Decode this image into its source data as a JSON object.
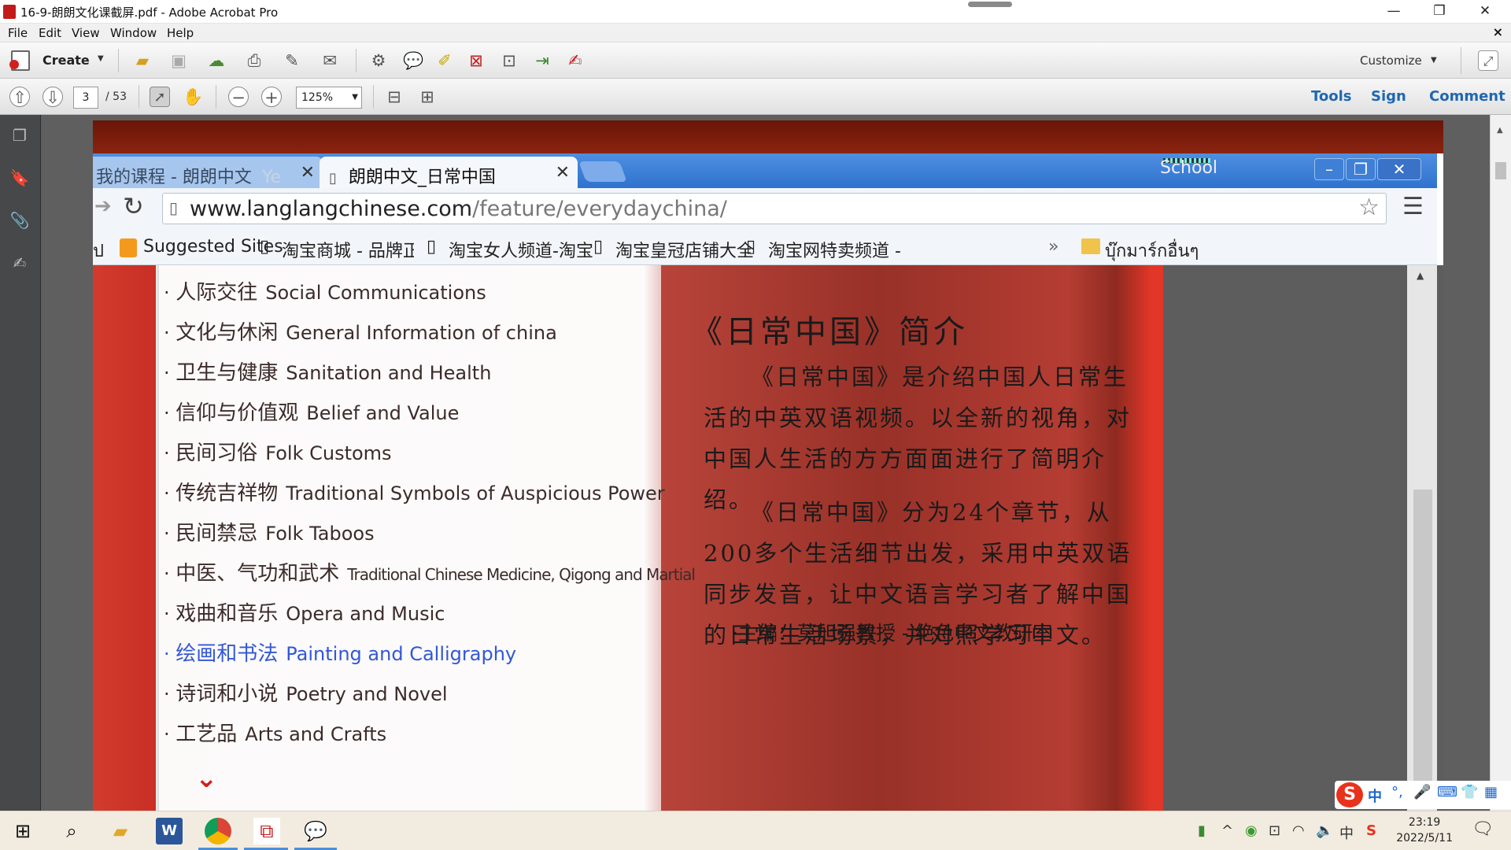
{
  "window": {
    "title": "16-9-朗朗文化课截屏.pdf - Adobe Acrobat Pro",
    "controls": {
      "minimize": "—",
      "maximize": "❐",
      "close": "✕"
    }
  },
  "menu": {
    "items": [
      "File",
      "Edit",
      "View",
      "Window",
      "Help"
    ],
    "close": "×"
  },
  "toolbar": {
    "create_label": "Create",
    "customize_label": "Customize"
  },
  "nav": {
    "current_page": "3",
    "total_pages": "/ 53",
    "zoom": "125%",
    "tools_label": "Tools",
    "sign_label": "Sign",
    "comment_label": "Comment"
  },
  "browser": {
    "tab1_title": "我的课程 - 朗朗中文",
    "tab1_suffix": "Ye",
    "tab2_title": "朗朗中文_日常中国",
    "school_label": "School",
    "url_host": "www.langlangchinese.com",
    "url_path": "/feature/everydaychina/",
    "bookmarks": [
      "Suggested Sites",
      "淘宝商城 - 品牌正品",
      "淘宝女人频道-淘宝",
      "淘宝皇冠店铺大全",
      "淘宝网特卖频道 - 每"
    ],
    "bookmarks_prefix": "ป",
    "bookmarks_more": "»",
    "other_bookmarks": "บุ๊กมาร์กอื่นๆ"
  },
  "page": {
    "nav_items": [
      {
        "cn": "人际交往",
        "en": "Social Communications"
      },
      {
        "cn": "文化与休闲",
        "en": "General Information of china"
      },
      {
        "cn": "卫生与健康",
        "en": "Sanitation and Health"
      },
      {
        "cn": "信仰与价值观",
        "en": "Belief and Value"
      },
      {
        "cn": "民间习俗",
        "en": "Folk Customs"
      },
      {
        "cn": "传统吉祥物",
        "en": "Traditional Symbols of Auspicious Power"
      },
      {
        "cn": "民间禁忌",
        "en": "Folk Taboos"
      },
      {
        "cn": "中医、气功和武术",
        "en": "Traditional Chinese Medicine, Qigong and Martial"
      },
      {
        "cn": "戏曲和音乐",
        "en": "Opera and Music"
      },
      {
        "cn": "绘画和书法",
        "en": "Painting and Calligraphy"
      },
      {
        "cn": "诗词和小说",
        "en": "Poetry and Novel"
      },
      {
        "cn": "工艺品",
        "en": "Arts and Crafts"
      }
    ],
    "active_index": 9,
    "intro_title": "《日常中国》简介",
    "para1": "《日常中国》是介绍中国人日常生活的中英双语视频。以全新的视角，对中国人生活的方方面面进行了简明介绍。",
    "para2": "《日常中国》分为24个章节，从200多个生活细节出发，采用中英双语同步发音，让中文语言学习者了解中国的日常生活场景，并对照学习中文。",
    "editor": "·主编：莫旭强教授 - 绝色中文教研室"
  },
  "ime": {
    "label": "中"
  },
  "taskbar": {
    "time": "23:19",
    "date": "2022/5/11"
  }
}
